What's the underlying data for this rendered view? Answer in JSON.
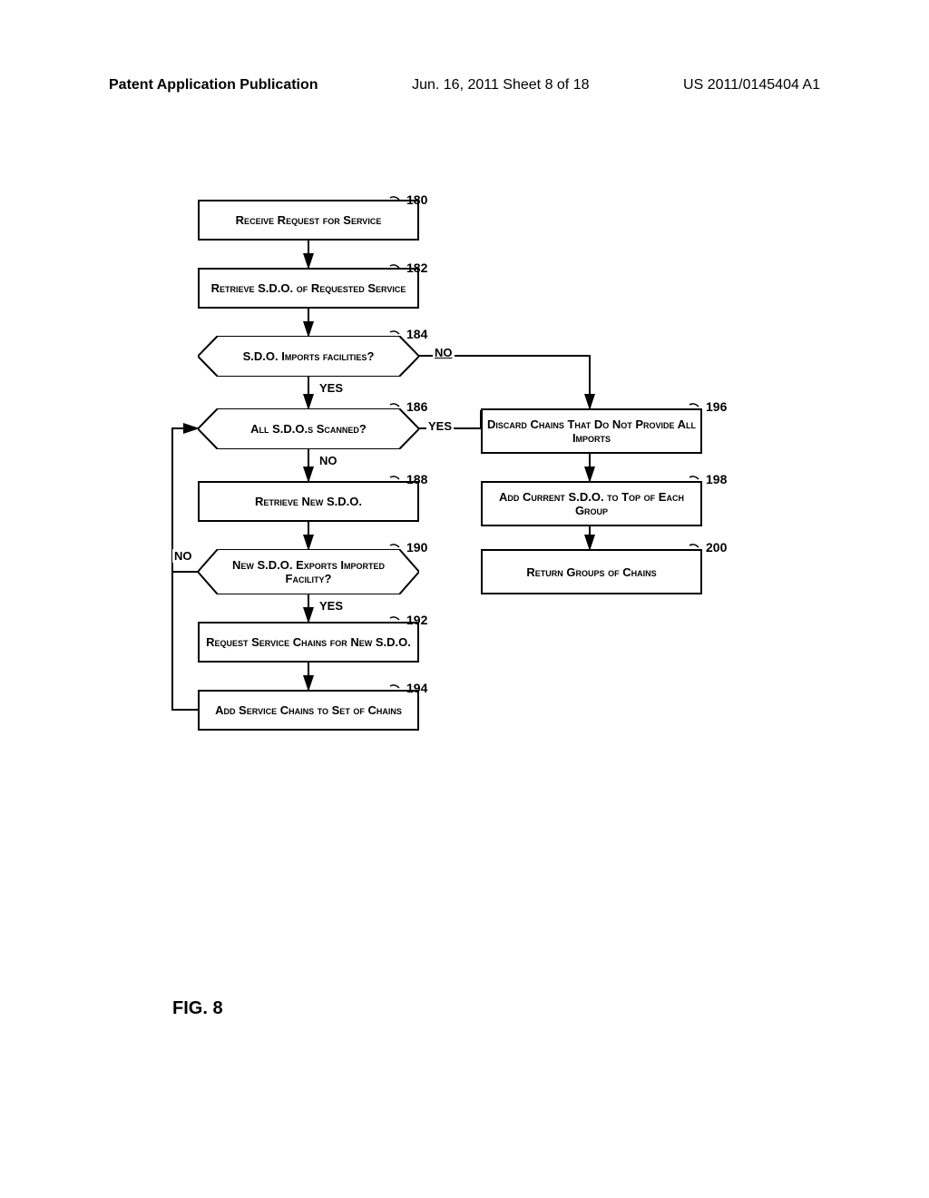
{
  "header": {
    "left": "Patent Application Publication",
    "center": "Jun. 16, 2011  Sheet 8 of 18",
    "right": "US 2011/0145404 A1"
  },
  "boxes": {
    "b180": {
      "text": "Receive Request for Service",
      "ref": "180"
    },
    "b182": {
      "text": "Retrieve S.D.O. of Requested Service",
      "ref": "182"
    },
    "b184": {
      "text": "S.D.O. Imports facilities?",
      "ref": "184"
    },
    "b186": {
      "text": "All S.D.O.s Scanned?",
      "ref": "186"
    },
    "b188": {
      "text": "Retrieve New S.D.O.",
      "ref": "188"
    },
    "b190": {
      "text": "New S.D.O. Exports Imported Facility?",
      "ref": "190"
    },
    "b192": {
      "text": "Request Service Chains for New S.D.O.",
      "ref": "192"
    },
    "b194": {
      "text": "Add Service Chains to Set of Chains",
      "ref": "194"
    },
    "b196": {
      "text": "Discard Chains That Do Not Provide All Imports",
      "ref": "196"
    },
    "b198": {
      "text": "Add Current S.D.O. to Top of Each Group",
      "ref": "198"
    },
    "b200": {
      "text": "Return Groups of Chains",
      "ref": "200"
    }
  },
  "labels": {
    "yes": "YES",
    "no": "NO",
    "no_underline": "NO"
  },
  "figure": "FIG. 8"
}
